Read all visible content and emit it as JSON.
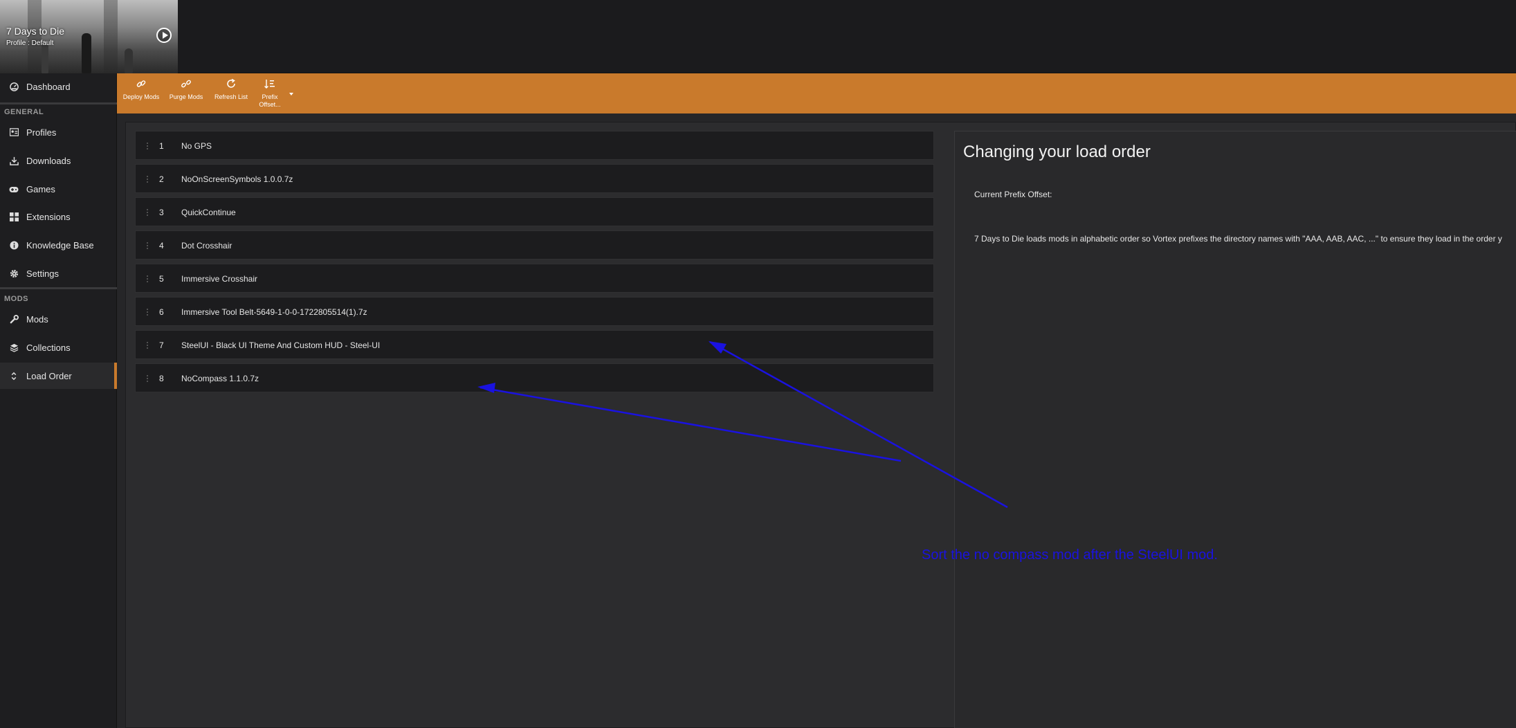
{
  "header": {
    "game_title": "7 Days to Die",
    "profile_text": "Profile : Default",
    "play_icon": "play-circle-icon"
  },
  "sidebar": {
    "top_items": [
      {
        "label": "Dashboard",
        "icon": "dashboard-icon"
      }
    ],
    "general_header": "GENERAL",
    "general_items": [
      {
        "label": "Profiles",
        "icon": "profiles-icon"
      },
      {
        "label": "Downloads",
        "icon": "download-icon"
      },
      {
        "label": "Games",
        "icon": "gamepad-icon"
      },
      {
        "label": "Extensions",
        "icon": "extensions-icon"
      },
      {
        "label": "Knowledge Base",
        "icon": "info-icon"
      },
      {
        "label": "Settings",
        "icon": "gear-icon"
      }
    ],
    "mods_header": "MODS",
    "mods_items": [
      {
        "label": "Mods",
        "icon": "wrench-icon"
      },
      {
        "label": "Collections",
        "icon": "layers-icon"
      },
      {
        "label": "Load Order",
        "icon": "sort-icon",
        "active": true
      }
    ]
  },
  "toolbar": {
    "deploy": "Deploy Mods",
    "purge": "Purge Mods",
    "refresh": "Refresh List",
    "prefix_line1": "Prefix",
    "prefix_line2": "Offset..."
  },
  "load_order": [
    {
      "index": "1",
      "name": "No GPS"
    },
    {
      "index": "2",
      "name": "NoOnScreenSymbols 1.0.0.7z"
    },
    {
      "index": "3",
      "name": "QuickContinue"
    },
    {
      "index": "4",
      "name": "Dot Crosshair"
    },
    {
      "index": "5",
      "name": "Immersive Crosshair"
    },
    {
      "index": "6",
      "name": "Immersive Tool Belt-5649-1-0-0-1722805514(1).7z"
    },
    {
      "index": "7",
      "name": "SteelUI - Black UI Theme And Custom HUD - Steel-UI"
    },
    {
      "index": "8",
      "name": "NoCompass 1.1.0.7z"
    }
  ],
  "info_panel": {
    "title": "Changing your load order",
    "offset_label": "Current Prefix Offset:",
    "description": "7 Days to Die loads mods in alphabetic order so Vortex prefixes the directory names with \"AAA, AAB, AAC, ...\" to ensure they load in the order y"
  },
  "annotation": {
    "text": "Sort  the no compass mod after the SteelUI mod.",
    "color": "#1a12e0"
  },
  "colors": {
    "accent": "#c97a2c",
    "background": "#262628",
    "sidebar": "#1e1e20"
  }
}
